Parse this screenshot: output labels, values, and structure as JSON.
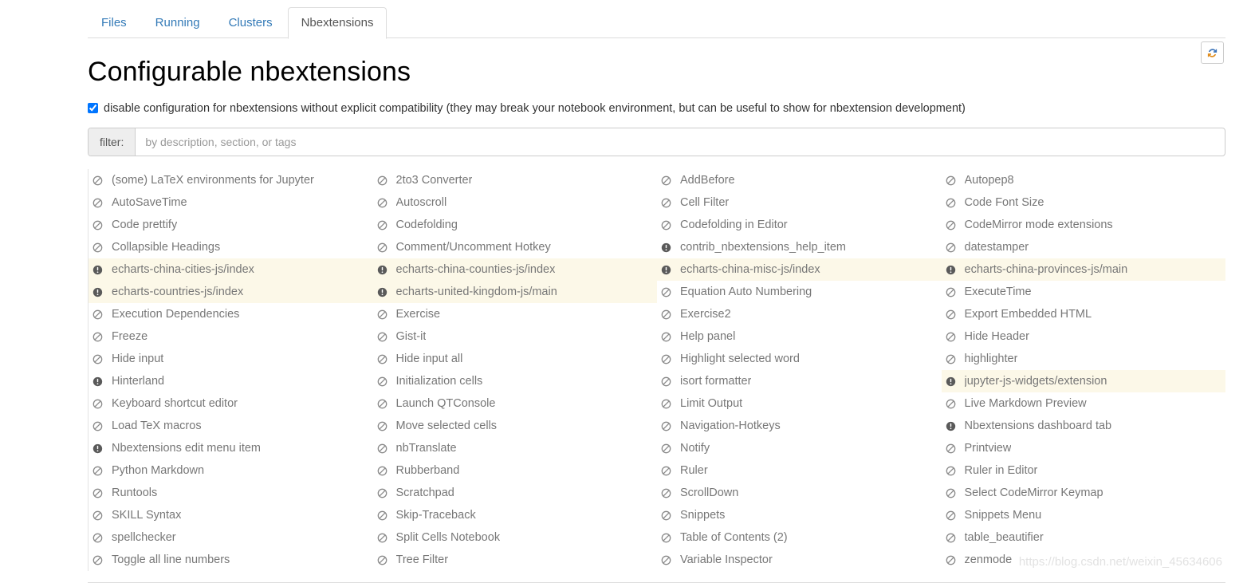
{
  "tabs": [
    {
      "label": "Files",
      "active": false
    },
    {
      "label": "Running",
      "active": false
    },
    {
      "label": "Clusters",
      "active": false
    },
    {
      "label": "Nbextensions",
      "active": true
    }
  ],
  "toolbar": {
    "refresh_icon": "refresh-icon",
    "refresh_title": "Refresh"
  },
  "page": {
    "title": "Configurable nbextensions"
  },
  "compat": {
    "checked": true,
    "label": "disable configuration for nbextensions without explicit compatibility (they may break your notebook environment, but can be useful to show for nbextension development)"
  },
  "filter": {
    "label": "filter:",
    "value": "",
    "placeholder": "by description, section, or tags"
  },
  "legend": {
    "disabled_icon": "ban-icon",
    "incompatible_icon": "exclamation-circle-icon",
    "highlight_color": "#fcf8e8",
    "label_color": "#777777"
  },
  "extensions": [
    {
      "name": "(some) LaTeX environments for Jupyter",
      "icon": "ban-icon",
      "highlighted": false
    },
    {
      "name": "2to3 Converter",
      "icon": "ban-icon",
      "highlighted": false
    },
    {
      "name": "AddBefore",
      "icon": "ban-icon",
      "highlighted": false
    },
    {
      "name": "Autopep8",
      "icon": "ban-icon",
      "highlighted": false
    },
    {
      "name": "AutoSaveTime",
      "icon": "ban-icon",
      "highlighted": false
    },
    {
      "name": "Autoscroll",
      "icon": "ban-icon",
      "highlighted": false
    },
    {
      "name": "Cell Filter",
      "icon": "ban-icon",
      "highlighted": false
    },
    {
      "name": "Code Font Size",
      "icon": "ban-icon",
      "highlighted": false
    },
    {
      "name": "Code prettify",
      "icon": "ban-icon",
      "highlighted": false
    },
    {
      "name": "Codefolding",
      "icon": "ban-icon",
      "highlighted": false
    },
    {
      "name": "Codefolding in Editor",
      "icon": "ban-icon",
      "highlighted": false
    },
    {
      "name": "CodeMirror mode extensions",
      "icon": "ban-icon",
      "highlighted": false
    },
    {
      "name": "Collapsible Headings",
      "icon": "ban-icon",
      "highlighted": false
    },
    {
      "name": "Comment/Uncomment Hotkey",
      "icon": "ban-icon",
      "highlighted": false
    },
    {
      "name": "contrib_nbextensions_help_item",
      "icon": "exclamation-circle-icon",
      "highlighted": false
    },
    {
      "name": "datestamper",
      "icon": "ban-icon",
      "highlighted": false
    },
    {
      "name": "echarts-china-cities-js/index",
      "icon": "exclamation-circle-icon",
      "highlighted": true
    },
    {
      "name": "echarts-china-counties-js/index",
      "icon": "exclamation-circle-icon",
      "highlighted": true
    },
    {
      "name": "echarts-china-misc-js/index",
      "icon": "exclamation-circle-icon",
      "highlighted": true
    },
    {
      "name": "echarts-china-provinces-js/main",
      "icon": "exclamation-circle-icon",
      "highlighted": true
    },
    {
      "name": "echarts-countries-js/index",
      "icon": "exclamation-circle-icon",
      "highlighted": true
    },
    {
      "name": "echarts-united-kingdom-js/main",
      "icon": "exclamation-circle-icon",
      "highlighted": true
    },
    {
      "name": "Equation Auto Numbering",
      "icon": "ban-icon",
      "highlighted": false
    },
    {
      "name": "ExecuteTime",
      "icon": "ban-icon",
      "highlighted": false
    },
    {
      "name": "Execution Dependencies",
      "icon": "ban-icon",
      "highlighted": false
    },
    {
      "name": "Exercise",
      "icon": "ban-icon",
      "highlighted": false
    },
    {
      "name": "Exercise2",
      "icon": "ban-icon",
      "highlighted": false
    },
    {
      "name": "Export Embedded HTML",
      "icon": "ban-icon",
      "highlighted": false
    },
    {
      "name": "Freeze",
      "icon": "ban-icon",
      "highlighted": false
    },
    {
      "name": "Gist-it",
      "icon": "ban-icon",
      "highlighted": false
    },
    {
      "name": "Help panel",
      "icon": "ban-icon",
      "highlighted": false
    },
    {
      "name": "Hide Header",
      "icon": "ban-icon",
      "highlighted": false
    },
    {
      "name": "Hide input",
      "icon": "ban-icon",
      "highlighted": false
    },
    {
      "name": "Hide input all",
      "icon": "ban-icon",
      "highlighted": false
    },
    {
      "name": "Highlight selected word",
      "icon": "ban-icon",
      "highlighted": false
    },
    {
      "name": "highlighter",
      "icon": "ban-icon",
      "highlighted": false
    },
    {
      "name": "Hinterland",
      "icon": "exclamation-circle-icon",
      "highlighted": false
    },
    {
      "name": "Initialization cells",
      "icon": "ban-icon",
      "highlighted": false
    },
    {
      "name": "isort formatter",
      "icon": "ban-icon",
      "highlighted": false
    },
    {
      "name": "jupyter-js-widgets/extension",
      "icon": "exclamation-circle-icon",
      "highlighted": true
    },
    {
      "name": "Keyboard shortcut editor",
      "icon": "ban-icon",
      "highlighted": false
    },
    {
      "name": "Launch QTConsole",
      "icon": "ban-icon",
      "highlighted": false
    },
    {
      "name": "Limit Output",
      "icon": "ban-icon",
      "highlighted": false
    },
    {
      "name": "Live Markdown Preview",
      "icon": "ban-icon",
      "highlighted": false
    },
    {
      "name": "Load TeX macros",
      "icon": "ban-icon",
      "highlighted": false
    },
    {
      "name": "Move selected cells",
      "icon": "ban-icon",
      "highlighted": false
    },
    {
      "name": "Navigation-Hotkeys",
      "icon": "ban-icon",
      "highlighted": false
    },
    {
      "name": "Nbextensions dashboard tab",
      "icon": "exclamation-circle-icon",
      "highlighted": false
    },
    {
      "name": "Nbextensions edit menu item",
      "icon": "exclamation-circle-icon",
      "highlighted": false
    },
    {
      "name": "nbTranslate",
      "icon": "ban-icon",
      "highlighted": false
    },
    {
      "name": "Notify",
      "icon": "ban-icon",
      "highlighted": false
    },
    {
      "name": "Printview",
      "icon": "ban-icon",
      "highlighted": false
    },
    {
      "name": "Python Markdown",
      "icon": "ban-icon",
      "highlighted": false
    },
    {
      "name": "Rubberband",
      "icon": "ban-icon",
      "highlighted": false
    },
    {
      "name": "Ruler",
      "icon": "ban-icon",
      "highlighted": false
    },
    {
      "name": "Ruler in Editor",
      "icon": "ban-icon",
      "highlighted": false
    },
    {
      "name": "Runtools",
      "icon": "ban-icon",
      "highlighted": false
    },
    {
      "name": "Scratchpad",
      "icon": "ban-icon",
      "highlighted": false
    },
    {
      "name": "ScrollDown",
      "icon": "ban-icon",
      "highlighted": false
    },
    {
      "name": "Select CodeMirror Keymap",
      "icon": "ban-icon",
      "highlighted": false
    },
    {
      "name": "SKILL Syntax",
      "icon": "ban-icon",
      "highlighted": false
    },
    {
      "name": "Skip-Traceback",
      "icon": "ban-icon",
      "highlighted": false
    },
    {
      "name": "Snippets",
      "icon": "ban-icon",
      "highlighted": false
    },
    {
      "name": "Snippets Menu",
      "icon": "ban-icon",
      "highlighted": false
    },
    {
      "name": "spellchecker",
      "icon": "ban-icon",
      "highlighted": false
    },
    {
      "name": "Split Cells Notebook",
      "icon": "ban-icon",
      "highlighted": false
    },
    {
      "name": "Table of Contents (2)",
      "icon": "ban-icon",
      "highlighted": false
    },
    {
      "name": "table_beautifier",
      "icon": "ban-icon",
      "highlighted": false
    },
    {
      "name": "Toggle all line numbers",
      "icon": "ban-icon",
      "highlighted": false
    },
    {
      "name": "Tree Filter",
      "icon": "ban-icon",
      "highlighted": false
    },
    {
      "name": "Variable Inspector",
      "icon": "ban-icon",
      "highlighted": false
    },
    {
      "name": "zenmode",
      "icon": "ban-icon",
      "highlighted": false
    }
  ],
  "watermark": {
    "text": "https://blog.csdn.net/weixin_45634606"
  }
}
